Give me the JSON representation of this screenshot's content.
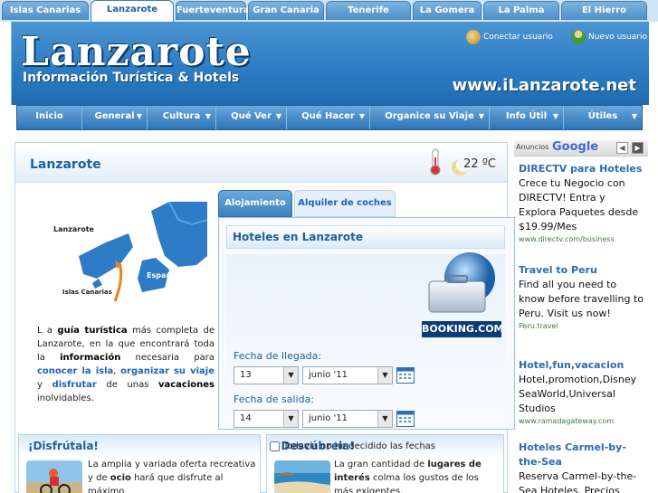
{
  "island_tabs": [
    {
      "label": "Islas Canarias",
      "active": false
    },
    {
      "label": "Lanzarote",
      "active": true
    },
    {
      "label": "Fuerteventura",
      "active": false
    },
    {
      "label": "Gran Canaria",
      "active": false
    },
    {
      "label": "Tenerife",
      "active": false
    },
    {
      "label": "La Gomera",
      "active": false
    },
    {
      "label": "La Palma",
      "active": false
    },
    {
      "label": "El Hierro",
      "active": false
    }
  ],
  "header": {
    "title": "Lanzarote",
    "subtitle": "Información Turística & Hotels",
    "url": "www.iLanzarote.net",
    "login_label": "Conectar usuario",
    "new_user_label": "Nuevo usuario"
  },
  "nav": [
    {
      "label": "Inicio",
      "dropdown": false
    },
    {
      "label": "General",
      "dropdown": true
    },
    {
      "label": "Cultura",
      "dropdown": true
    },
    {
      "label": "Qué Ver",
      "dropdown": true
    },
    {
      "label": "Qué Hacer",
      "dropdown": true
    },
    {
      "label": "Organice su Viaje",
      "dropdown": true
    },
    {
      "label": "Info Útil",
      "dropdown": true
    },
    {
      "label": "Útiles",
      "dropdown": true
    }
  ],
  "page": {
    "title": "Lanzarote",
    "temperature": "22 ºC"
  },
  "map": {
    "label_lanzarote": "Lanzarote",
    "label_espana": "España",
    "label_islas": "Islas Canarias"
  },
  "intro": {
    "p1": "L a ",
    "b1": "guía turística",
    "p2": " más completa de Lanzarote, en la que encontrará toda la ",
    "b2": "información",
    "p3": " necesaria para ",
    "l1": "conocer la isla",
    "p4": ", ",
    "l2": "organizar su viaje",
    "p5": " y ",
    "l3": "disfrutar",
    "p6": " de unas ",
    "b3": "vacaciones",
    "p7": " inolvidables."
  },
  "booking": {
    "tab_alojamiento": "Alojamiento",
    "tab_coches": "Alquiler de coches",
    "widget_title": "Hoteles en Lanzarote",
    "logo_text": "BOOKING.COM",
    "checkin_label": "Fecha de llegada:",
    "checkin_day": "13",
    "checkin_month": "junio '11",
    "checkout_label": "Fecha de salida:",
    "checkout_day": "14",
    "checkout_month": "junio '11",
    "no_dates_label": "Todavía no he decidido las fechas"
  },
  "boxes": {
    "enjoy_title": "¡Disfrútala!",
    "enjoy_t1": "La amplia y variada oferta recreativa y de ",
    "enjoy_b1": "ocio",
    "enjoy_t2": " hará que disfrute al máximo.",
    "discover_title": "¡Descúbrela!",
    "discover_t1": "La gran cantidad de ",
    "discover_b1": "lugares de interés",
    "discover_t2": " colma los gustos de los más exigentes."
  },
  "ads": {
    "label": "Anuncios",
    "brand": "Google",
    "items": [
      {
        "title": "DIRECTV para Hoteles",
        "text": "Crece tu Negocio con DIRECTV! Entra y Explora Paquetes desde $19.99/Mes",
        "url": "www.directv.com/business"
      },
      {
        "title": "Travel to Peru",
        "text": "Find all you need to know before travelling to Peru. Visit us now!",
        "url": "Peru.travel"
      },
      {
        "title": "Hotel,fun,vacacion",
        "text": "Hotel,promotion,Disney SeaWorld,Universal Studios",
        "url": "www.ramadagateway.com"
      },
      {
        "title": "Hoteles Carmel-by-the-Sea",
        "text": "Reserva Carmel-by-the-Sea Hoteles. Precios",
        "url": ""
      }
    ]
  },
  "colors": {
    "header_blue": "#2e7dc4",
    "link_blue": "#1f62b5",
    "title_blue": "#1f5f9c"
  }
}
